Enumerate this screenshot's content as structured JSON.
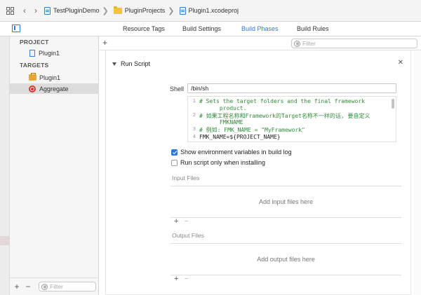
{
  "jumpbar": {
    "crumbs": [
      {
        "label": "TestPluginDemo"
      },
      {
        "label": "PluginProjects"
      },
      {
        "label": "Plugin1.xcodeproj"
      }
    ]
  },
  "tabs": [
    {
      "label": "Resource Tags",
      "active": false
    },
    {
      "label": "Build Settings",
      "active": false
    },
    {
      "label": "Build Phases",
      "active": true
    },
    {
      "label": "Build Rules",
      "active": false
    }
  ],
  "sidebar": {
    "project_header": "PROJECT",
    "project_item": "Plugin1",
    "targets_header": "TARGETS",
    "targets": [
      {
        "label": "Plugin1",
        "icon": "toolbox-icon",
        "selected": false
      },
      {
        "label": "Aggregate",
        "icon": "target-icon",
        "selected": true
      }
    ],
    "filter_placeholder": "Filter"
  },
  "main": {
    "filter_placeholder": "Filter",
    "phase_title": "Run Script",
    "shell_label": "Shell",
    "shell_value": "/bin/sh",
    "script_lines": [
      {
        "num": "1",
        "text": "# Sets the target folders and the final framework",
        "kind": "comment"
      },
      {
        "num": "",
        "text": "      product.",
        "kind": "comment"
      },
      {
        "num": "2",
        "text": "# 如果工程名称和Framework的Target名称不一样的话, 要自定义",
        "kind": "comment"
      },
      {
        "num": "",
        "text": "      FMKNAME",
        "kind": "comment"
      },
      {
        "num": "3",
        "text": "# 例如: FMK_NAME = \"MyFramework\"",
        "kind": "comment"
      },
      {
        "num": "4",
        "text": "FMK_NAME=${PROJECT_NAME}",
        "kind": "plain"
      }
    ],
    "show_env_label": "Show environment variables in build log",
    "show_env_checked": true,
    "run_only_label": "Run script only when installing",
    "run_only_checked": false,
    "input_files_label": "Input Files",
    "input_files_placeholder": "Add input files here",
    "output_files_label": "Output Files",
    "output_files_placeholder": "Add output files here"
  },
  "colors": {
    "accent": "#2f77e0",
    "comment": "#2e8a37"
  }
}
